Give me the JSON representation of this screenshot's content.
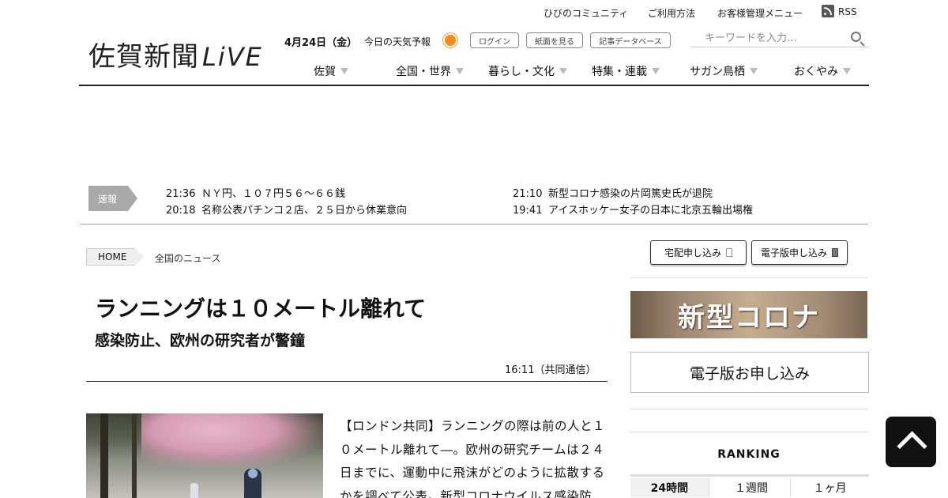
{
  "utility_links": [
    "ひびのコミュニティ",
    "ご利用方法",
    "お客様管理メニュー",
    "RSS"
  ],
  "logo": {
    "main": "佐賀新聞",
    "live": "LiVE"
  },
  "date": "4月24日（金）",
  "weather_label": "今日の天気予報",
  "header_buttons": [
    "ログイン",
    "紙面を見る",
    "記事データベース"
  ],
  "search": {
    "placeholder": "キーワードを入力…"
  },
  "nav": [
    "佐賀",
    "全国・世界",
    "暮らし・文化",
    "特集・連載",
    "サガン鳥栖",
    "おくやみ"
  ],
  "breaking": {
    "label": "速報",
    "items": [
      {
        "time": "21:36",
        "text": "ＮＹ円、１０７円５６～６６銭"
      },
      {
        "time": "21:10",
        "text": "新型コロナ感染の片岡篤史氏が退院"
      },
      {
        "time": "20:18",
        "text": "名称公表パチンコ２店、２５日から休業意向"
      },
      {
        "time": "19:41",
        "text": "アイスホッケー女子の日本に北京五輪出場権"
      }
    ]
  },
  "breadcrumb": {
    "home": "HOME",
    "current": "全国のニュース"
  },
  "article": {
    "headline": "ランニングは１０メートル離れて",
    "subhead": "感染防止、欧州の研究者が警鐘",
    "byline": "16:11（共同通信）",
    "body": "【ロンドン共同】ランニングの際は前の人と１０メートル離れて―。欧州の研究チームは２４日までに、運動中に飛沫がどのように拡散するかを調べて公表。新型コロナウイルス感染防"
  },
  "sidebar": {
    "order_buttons": [
      "宅配申し込み",
      "電子版申し込み"
    ],
    "corona_banner": "新型コロナ",
    "digital_signup": "電子版お申し込み",
    "ranking_title": "RANKING",
    "ranking_tabs": [
      "24時間",
      "１週間",
      "１ヶ月"
    ]
  },
  "colors": {
    "accent_sun": "#ff8a1c",
    "breaking_tag": "#a9a9a9",
    "to_top": "#111111"
  }
}
